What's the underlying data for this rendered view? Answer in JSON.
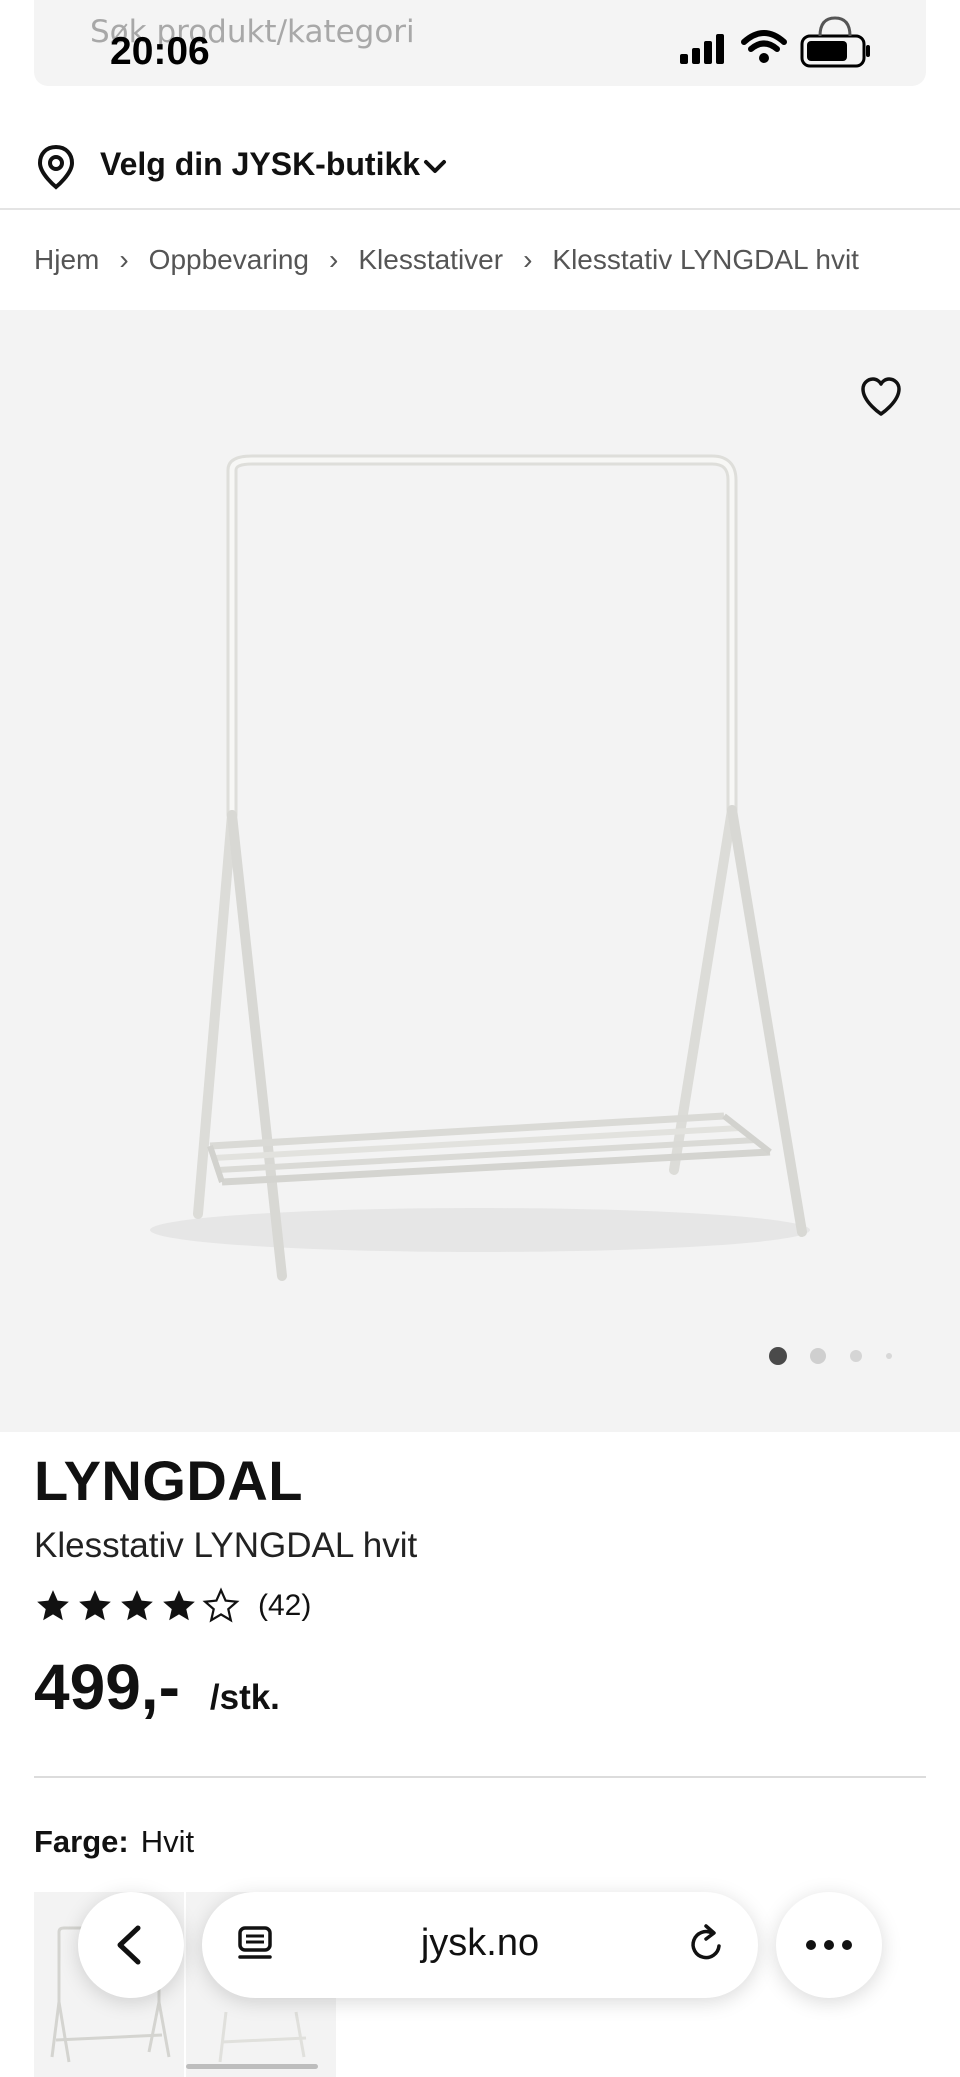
{
  "status_bar": {
    "time": "20:06"
  },
  "search": {
    "placeholder": "Søk produkt/kategori"
  },
  "store": {
    "label": "Velg din JYSK-butikk"
  },
  "breadcrumb": [
    "Hjem",
    "Oppbevaring",
    "Klesstativer",
    "Klesstativ LYNGDAL hvit"
  ],
  "breadcrumb_separator": "›",
  "product": {
    "brand": "LYNGDAL",
    "name": "Klesstativ LYNGDAL hvit",
    "rating": 4,
    "rating_max": 5,
    "review_count": "(42)",
    "price": "499,-",
    "price_unit": "/stk.",
    "color_label": "Farge:",
    "color_value": "Hvit"
  },
  "gallery": {
    "image_count": 4,
    "active_index": 0
  },
  "browser": {
    "url": "jysk.no"
  },
  "colors": {
    "image_bg": "#f3f3f3",
    "text": "#111111",
    "muted": "#555555"
  }
}
